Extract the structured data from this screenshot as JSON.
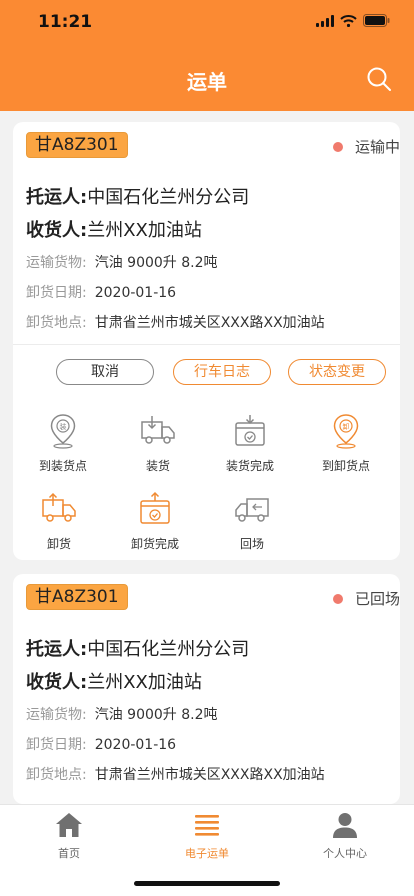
{
  "status_bar": {
    "time": "11:21"
  },
  "header": {
    "title": "运单"
  },
  "orders": [
    {
      "plate": "甘A8Z301",
      "status": "运输中",
      "shipper_label": "托运人:",
      "shipper": "中国石化兰州分公司",
      "receiver_label": "收货人:",
      "receiver": "兰州XX加油站",
      "goods_label": "运输货物:",
      "goods": "汽油 9000升  8.2吨",
      "date_label": "卸货日期:",
      "date": "2020-01-16",
      "location_label": "卸货地点:",
      "location": "甘肃省兰州市城关区XXX路XX加油站",
      "buttons": {
        "cancel": "取消",
        "log": "行车日志",
        "change": "状态变更"
      },
      "actions": [
        "到装货点",
        "装货",
        "装货完成",
        "到卸货点",
        "卸货",
        "卸货完成",
        "回场"
      ]
    },
    {
      "plate": "甘A8Z301",
      "status": "已回场",
      "shipper_label": "托运人:",
      "shipper": "中国石化兰州分公司",
      "receiver_label": "收货人:",
      "receiver": "兰州XX加油站",
      "goods_label": "运输货物:",
      "goods": "汽油 9000升  8.2吨",
      "date_label": "卸货日期:",
      "date": "2020-01-16",
      "location_label": "卸货地点:",
      "location": "甘肃省兰州市城关区XXX路XX加油站"
    }
  ],
  "tabbar": {
    "home": "首页",
    "waybill": "电子运单",
    "profile": "个人中心"
  },
  "colors": {
    "brand": "#fb8a33",
    "status_dot": "#f07a6c",
    "plate_bg": "#fba542"
  }
}
